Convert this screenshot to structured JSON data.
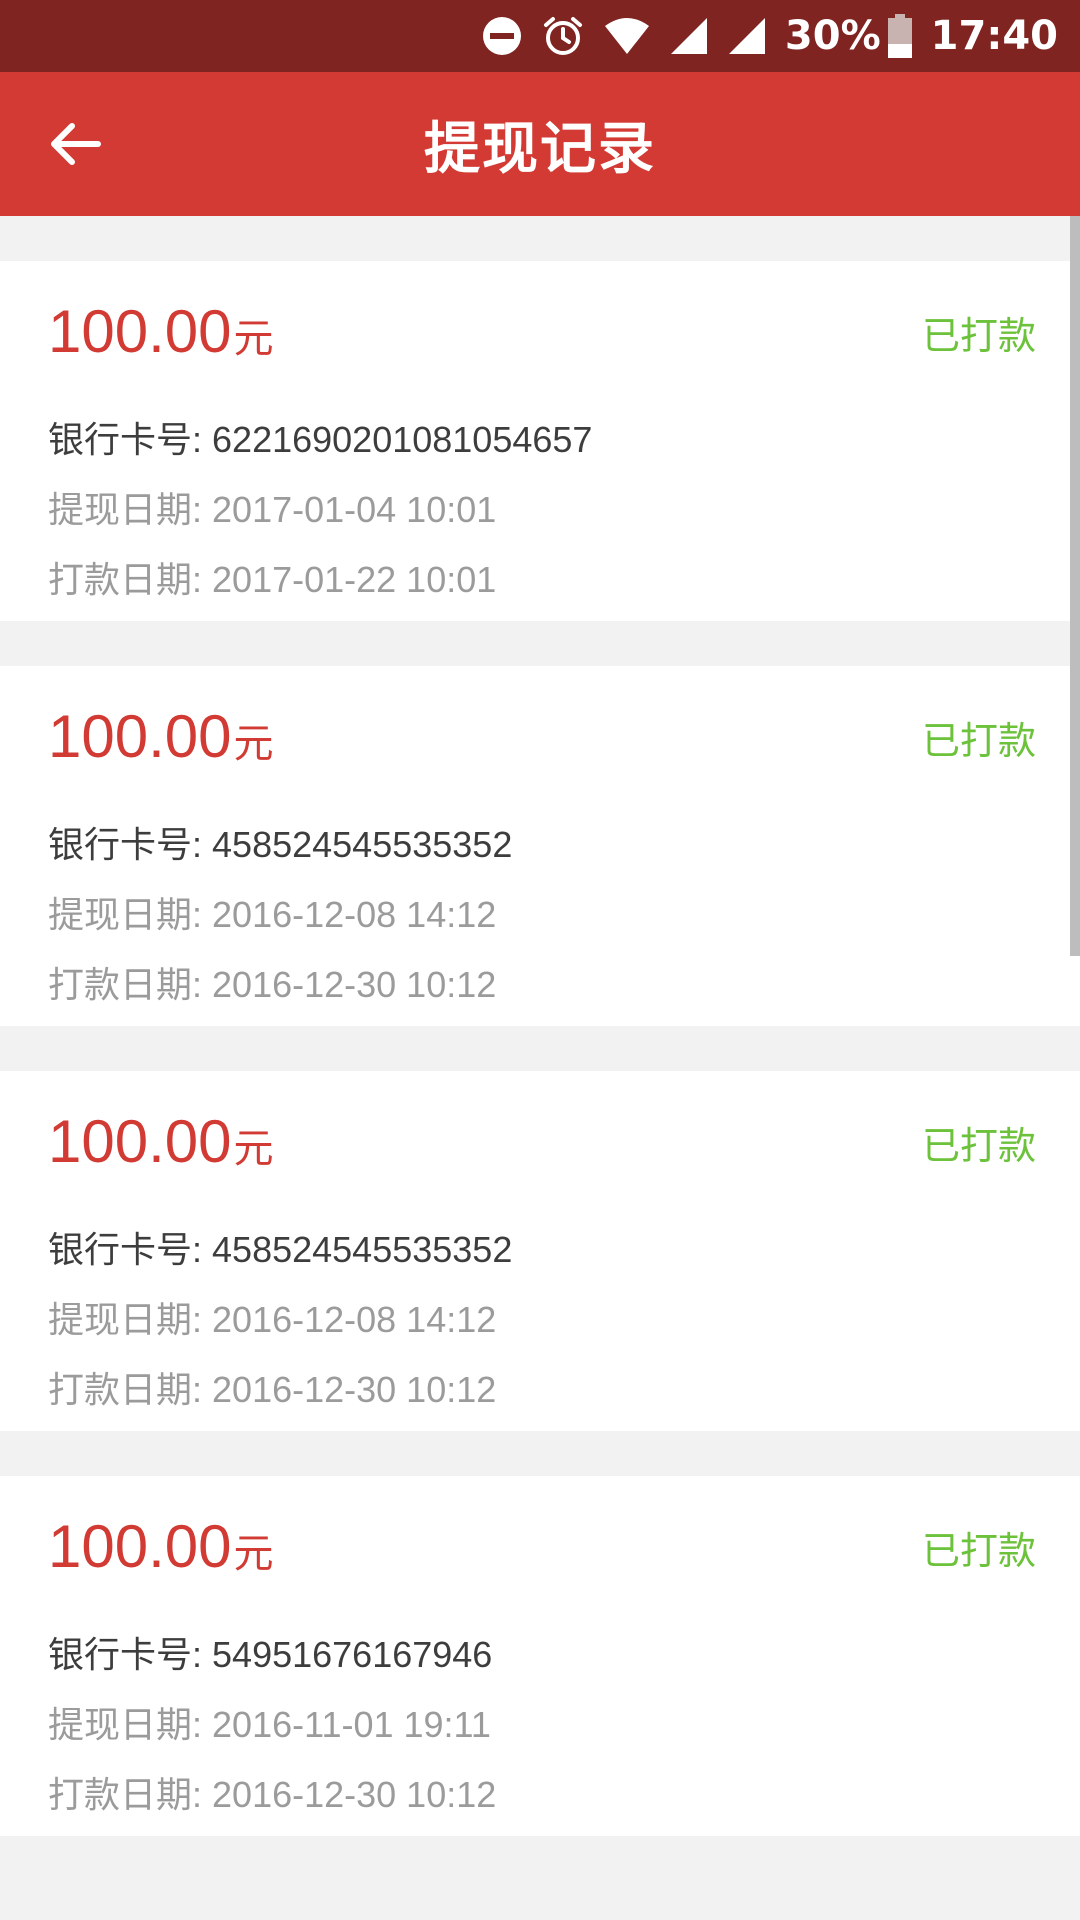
{
  "status_bar": {
    "battery": "30%",
    "time": "17:40"
  },
  "header": {
    "title": "提现记录"
  },
  "records": [
    {
      "amount": "100.00",
      "unit": "元",
      "status": "已打款",
      "card_label": "银行卡号:",
      "card": "6221690201081054657",
      "withdraw_label": "提现日期:",
      "withdraw_date": "2017-01-04 10:01",
      "pay_label": "打款日期:",
      "pay_date": "2017-01-22 10:01"
    },
    {
      "amount": "100.00",
      "unit": "元",
      "status": "已打款",
      "card_label": "银行卡号:",
      "card": "458524545535352",
      "withdraw_label": "提现日期:",
      "withdraw_date": "2016-12-08 14:12",
      "pay_label": "打款日期:",
      "pay_date": "2016-12-30 10:12"
    },
    {
      "amount": "100.00",
      "unit": "元",
      "status": "已打款",
      "card_label": "银行卡号:",
      "card": "458524545535352",
      "withdraw_label": "提现日期:",
      "withdraw_date": "2016-12-08 14:12",
      "pay_label": "打款日期:",
      "pay_date": "2016-12-30 10:12"
    },
    {
      "amount": "100.00",
      "unit": "元",
      "status": "已打款",
      "card_label": "银行卡号:",
      "card": "54951676167946",
      "withdraw_label": "提现日期:",
      "withdraw_date": "2016-11-01 19:11",
      "pay_label": "打款日期:",
      "pay_date": "2016-12-30 10:12"
    }
  ],
  "colors": {
    "status_bar_bg": "#7f2420",
    "app_bar_bg": "#d33a33",
    "amount": "#d23a34",
    "status_paid": "#6cc23a"
  },
  "icons": [
    "dnd-icon",
    "alarm-icon",
    "wifi-icon",
    "signal-icon",
    "battery-icon",
    "back-arrow-icon"
  ]
}
